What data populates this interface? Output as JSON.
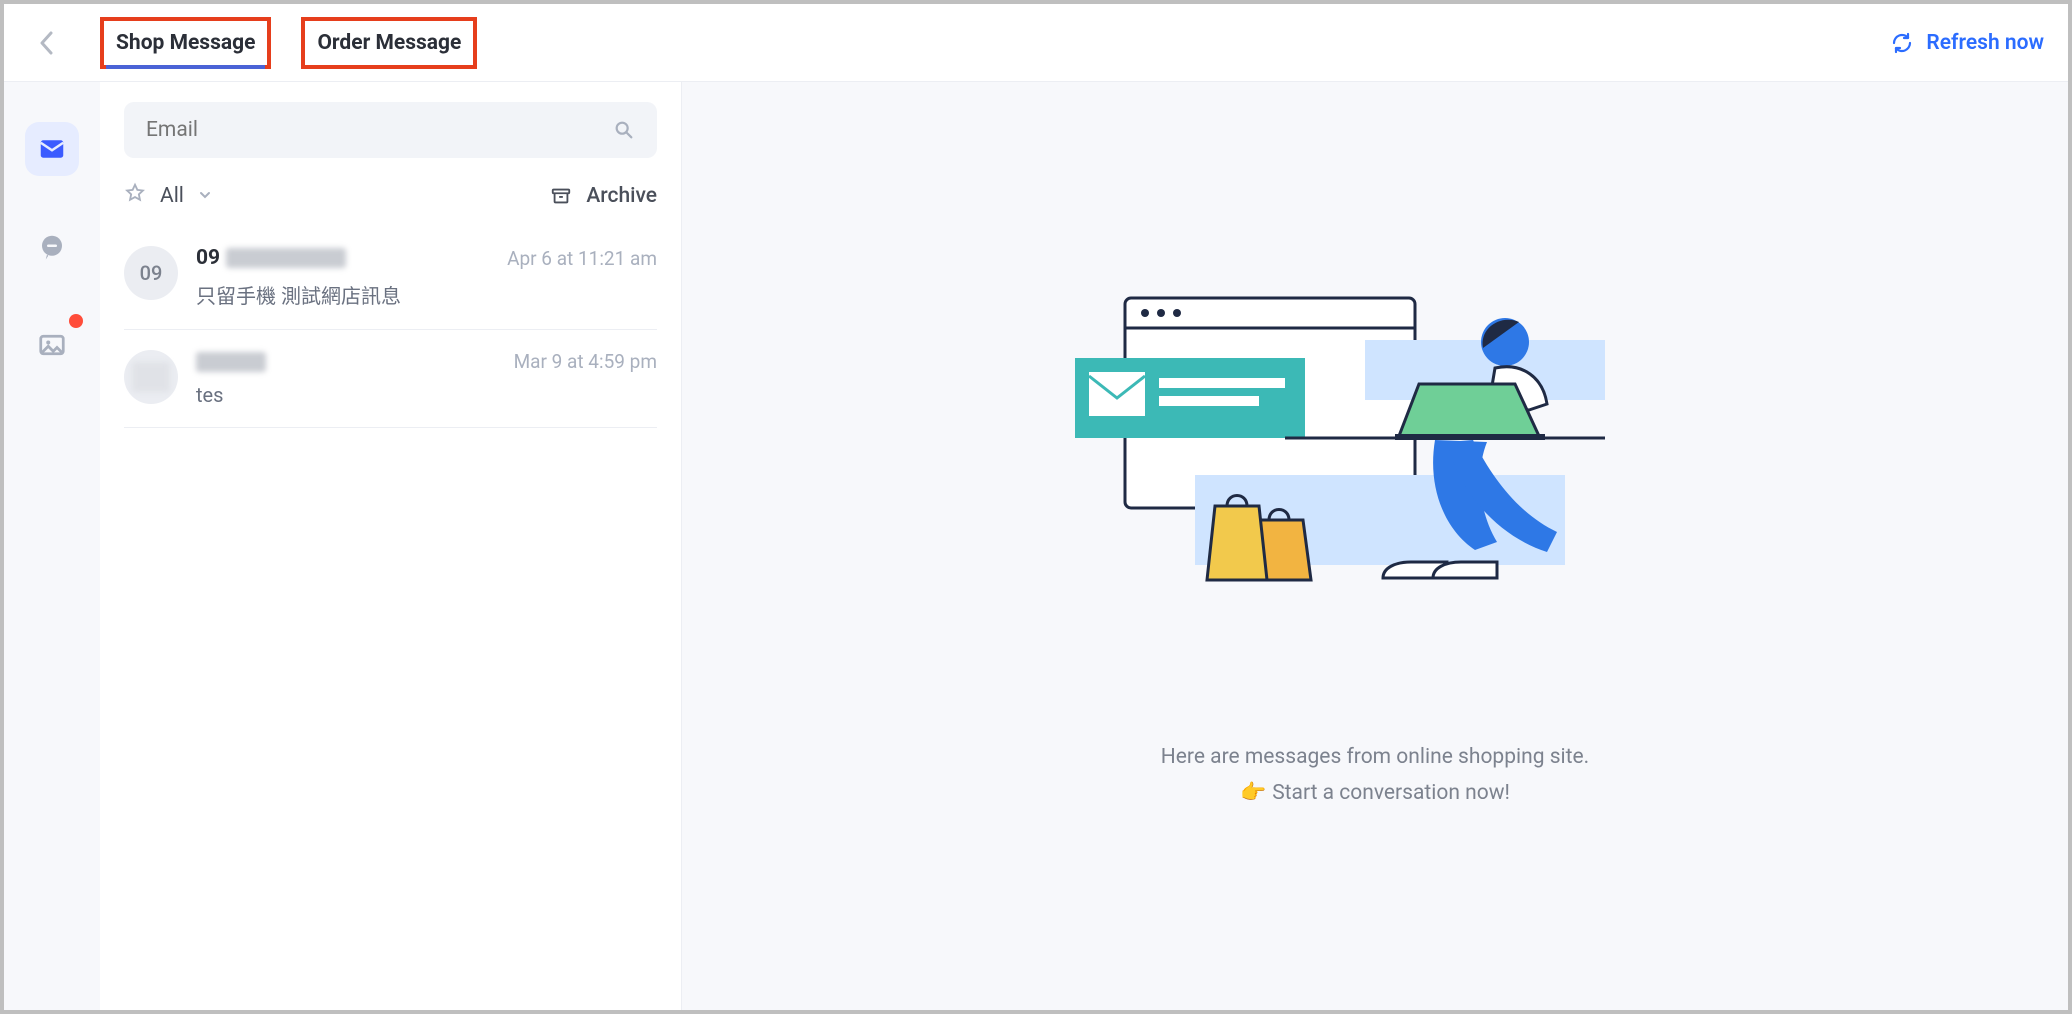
{
  "header": {
    "tabs": [
      "Shop Message",
      "Order Message"
    ],
    "active_tab": 0,
    "refresh_label": "Refresh now"
  },
  "rail": {
    "items": [
      {
        "name": "mail-icon",
        "active": true,
        "badge": false
      },
      {
        "name": "chat-icon",
        "active": false,
        "badge": false
      },
      {
        "name": "image-icon",
        "active": false,
        "badge": true
      }
    ]
  },
  "search": {
    "placeholder": "Email"
  },
  "list_bar": {
    "all_label": "All",
    "archive_label": "Archive"
  },
  "messages": [
    {
      "avatar_text": "09",
      "name_prefix": "09",
      "name_redacted": true,
      "preview": "只留手機 測試網店訊息",
      "time": "Apr 6 at 11:21 am"
    },
    {
      "avatar_text": "",
      "name_prefix": "",
      "name_redacted": true,
      "preview": "tes",
      "time": "Mar 9 at 4:59 pm"
    }
  ],
  "empty_state": {
    "line1": "Here are messages from online shopping site.",
    "line2_emoji": "👉",
    "line2": "Start a conversation now!"
  }
}
